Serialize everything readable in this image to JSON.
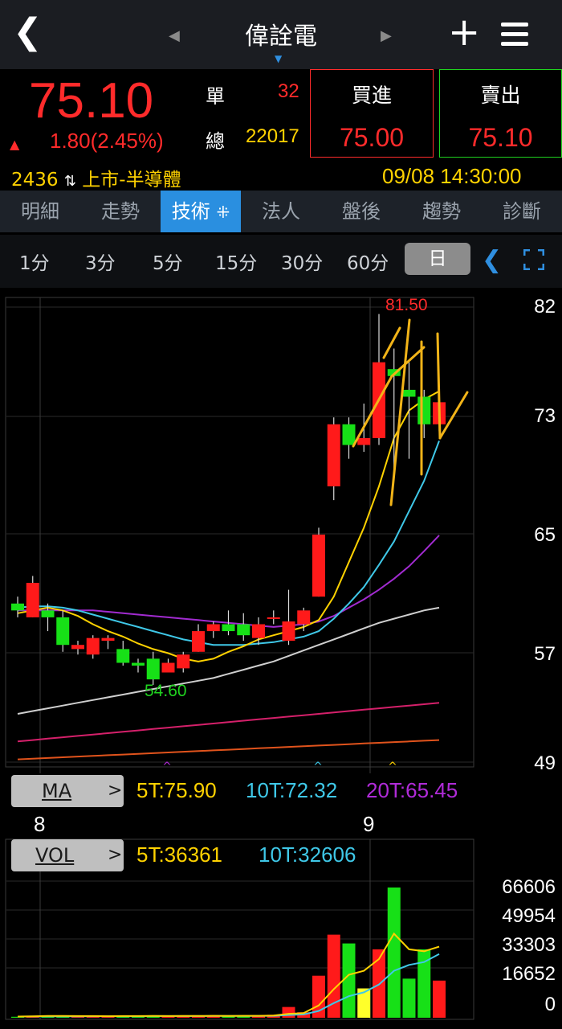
{
  "header": {
    "back_icon": "chevron-left-icon",
    "title": "偉詮電",
    "prev_icon": "caret-left-icon",
    "next_icon": "caret-right-icon",
    "add_icon": "plus-icon",
    "menu_icon": "hamburger-menu-icon"
  },
  "quote": {
    "price": "75.10",
    "change": "1.80(2.45%)",
    "single_label": "單",
    "single_value": "32",
    "total_label": "總",
    "total_value": "22017",
    "buy_label": "買進",
    "buy_price": "75.00",
    "sell_label": "賣出",
    "sell_price": "75.10",
    "code": "2436",
    "market": "上市-半導體",
    "datetime": "09/08 14:30:00",
    "up_color": "#ff2b2b",
    "down_color": "#1fd21f"
  },
  "tabs": [
    "明細",
    "走勢",
    "技術",
    "法人",
    "盤後",
    "趨勢",
    "診斷"
  ],
  "active_tab": "技術",
  "periods": [
    "1分",
    "3分",
    "5分",
    "15分",
    "30分",
    "60分",
    "日"
  ],
  "active_period": "日",
  "chart": {
    "y_ticks": [
      "82",
      "73",
      "65",
      "57",
      "49"
    ],
    "high_label": "81.50",
    "low_label": "54.60",
    "x_labels": [
      "8",
      "9"
    ],
    "ma": {
      "chip_label": "MA",
      "ma5": "5T:75.90",
      "ma10": "10T:72.32",
      "ma20": "20T:65.45"
    },
    "vol": {
      "chip_label": "VOL",
      "ma5": "5T:36361",
      "ma10": "10T:32606",
      "y_ticks": [
        "66606",
        "49954",
        "33303",
        "16652",
        "0"
      ]
    }
  },
  "chart_data": {
    "type": "candlestick",
    "ylim": [
      49,
      82
    ],
    "candles": [
      {
        "o": 60.5,
        "h": 61.0,
        "l": 59.5,
        "c": 60.0
      },
      {
        "o": 59.5,
        "h": 62.5,
        "l": 59.5,
        "c": 62.0
      },
      {
        "o": 60.0,
        "h": 60.5,
        "l": 58.5,
        "c": 59.5
      },
      {
        "o": 59.5,
        "h": 60.0,
        "l": 57.0,
        "c": 57.5
      },
      {
        "o": 57.2,
        "h": 57.8,
        "l": 56.8,
        "c": 57.5
      },
      {
        "o": 56.8,
        "h": 58.2,
        "l": 56.5,
        "c": 58.0
      },
      {
        "o": 57.8,
        "h": 58.2,
        "l": 57.2,
        "c": 58.0
      },
      {
        "o": 57.2,
        "h": 57.8,
        "l": 56.0,
        "c": 56.2
      },
      {
        "o": 56.2,
        "h": 56.5,
        "l": 55.5,
        "c": 56.0
      },
      {
        "o": 56.5,
        "h": 57.0,
        "l": 54.6,
        "c": 55.0
      },
      {
        "o": 55.5,
        "h": 56.5,
        "l": 55.5,
        "c": 56.2
      },
      {
        "o": 55.8,
        "h": 57.0,
        "l": 55.5,
        "c": 56.8
      },
      {
        "o": 57.0,
        "h": 59.0,
        "l": 57.0,
        "c": 58.5
      },
      {
        "o": 58.5,
        "h": 59.2,
        "l": 58.0,
        "c": 59.0
      },
      {
        "o": 59.0,
        "h": 60.0,
        "l": 58.2,
        "c": 58.5
      },
      {
        "o": 59.0,
        "h": 59.8,
        "l": 57.8,
        "c": 58.2
      },
      {
        "o": 58.0,
        "h": 59.5,
        "l": 57.5,
        "c": 59.0
      },
      {
        "o": 59.5,
        "h": 60.0,
        "l": 59.0,
        "c": 59.5
      },
      {
        "o": 57.8,
        "h": 61.5,
        "l": 57.5,
        "c": 59.2
      },
      {
        "o": 59.0,
        "h": 60.2,
        "l": 58.5,
        "c": 60.0
      },
      {
        "o": 61.0,
        "h": 66.0,
        "l": 61.0,
        "c": 65.5
      },
      {
        "o": 69.0,
        "h": 74.0,
        "l": 68.0,
        "c": 73.5
      },
      {
        "o": 73.5,
        "h": 74.0,
        "l": 71.0,
        "c": 72.0
      },
      {
        "o": 72.0,
        "h": 75.0,
        "l": 71.5,
        "c": 72.5
      },
      {
        "o": 72.5,
        "h": 81.5,
        "l": 72.0,
        "c": 78.0
      },
      {
        "o": 77.5,
        "h": 79.0,
        "l": 70.0,
        "c": 77.0
      },
      {
        "o": 76.0,
        "h": 78.0,
        "l": 71.0,
        "c": 75.5
      },
      {
        "o": 75.5,
        "h": 76.0,
        "l": 72.5,
        "c": 73.5
      },
      {
        "o": 73.5,
        "h": 76.0,
        "l": 73.0,
        "c": 75.1
      }
    ],
    "ma5": [
      59.8,
      60.0,
      60.2,
      60.0,
      59.6,
      59.0,
      58.5,
      58.1,
      57.6,
      57.2,
      56.9,
      56.5,
      56.3,
      56.5,
      57.0,
      57.4,
      57.9,
      58.2,
      58.5,
      58.8,
      59.3,
      61.0,
      63.5,
      66.0,
      69.0,
      72.5,
      74.5,
      75.3,
      75.9
    ],
    "ma10": [
      60.2,
      60.3,
      60.3,
      60.2,
      60.0,
      59.7,
      59.4,
      59.1,
      58.8,
      58.5,
      58.2,
      57.9,
      57.7,
      57.5,
      57.5,
      57.5,
      57.6,
      57.7,
      57.9,
      58.1,
      58.5,
      59.4,
      60.5,
      61.7,
      63.3,
      65.0,
      67.2,
      69.4,
      72.3
    ],
    "ma20": [
      60.0,
      60.0,
      60.0,
      60.0,
      60.0,
      60.0,
      59.9,
      59.8,
      59.7,
      59.6,
      59.5,
      59.4,
      59.3,
      59.2,
      59.1,
      59.0,
      58.9,
      58.8,
      58.9,
      59.0,
      59.2,
      59.6,
      60.2,
      60.8,
      61.5,
      62.3,
      63.2,
      64.3,
      65.45
    ],
    "ma60": [
      52.5,
      52.7,
      52.9,
      53.1,
      53.3,
      53.5,
      53.7,
      53.9,
      54.1,
      54.3,
      54.5,
      54.7,
      54.9,
      55.1,
      55.4,
      55.7,
      56.0,
      56.3,
      56.7,
      57.1,
      57.5,
      57.9,
      58.3,
      58.7,
      59.1,
      59.4,
      59.7,
      60.0,
      60.2
    ],
    "ma120": [
      50.5,
      50.6,
      50.7,
      50.8,
      50.9,
      51.0,
      51.1,
      51.2,
      51.3,
      51.4,
      51.5,
      51.6,
      51.7,
      51.8,
      51.9,
      52.0,
      52.1,
      52.2,
      52.3,
      52.4,
      52.5,
      52.6,
      52.7,
      52.8,
      52.9,
      53.0,
      53.1,
      53.2,
      53.3
    ],
    "ma240": [
      49.2,
      49.25,
      49.3,
      49.35,
      49.4,
      49.45,
      49.5,
      49.55,
      49.6,
      49.65,
      49.7,
      49.75,
      49.8,
      49.85,
      49.9,
      49.95,
      50.0,
      50.05,
      50.1,
      50.15,
      50.2,
      50.25,
      50.3,
      50.35,
      50.4,
      50.45,
      50.5,
      50.55,
      50.6
    ],
    "volume": [
      500,
      800,
      1200,
      900,
      700,
      800,
      600,
      1000,
      800,
      1100,
      700,
      900,
      1000,
      1200,
      800,
      900,
      1100,
      1500,
      5500,
      2800,
      21500,
      42500,
      38000,
      15000,
      35000,
      66606,
      20000,
      35000,
      19000
    ],
    "vol_ma5": [
      600,
      700,
      900,
      900,
      850,
      850,
      800,
      850,
      850,
      900,
      850,
      900,
      900,
      1000,
      950,
      1000,
      1000,
      1100,
      2000,
      2400,
      6300,
      14600,
      22000,
      24000,
      30000,
      43000,
      35000,
      34000,
      36361
    ],
    "vol_ma10": [
      600,
      650,
      700,
      750,
      750,
      800,
      800,
      800,
      800,
      850,
      850,
      850,
      850,
      900,
      900,
      950,
      950,
      1000,
      1400,
      1700,
      3500,
      7500,
      11000,
      13000,
      17000,
      24000,
      27000,
      28500,
      32606
    ],
    "vol_ylim": [
      0,
      66606
    ]
  }
}
